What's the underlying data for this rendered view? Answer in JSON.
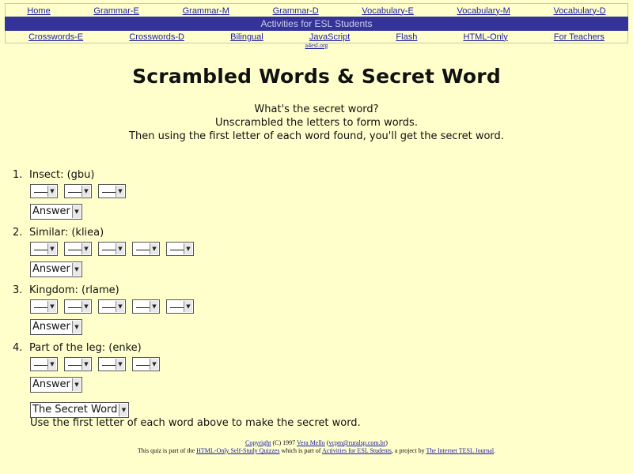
{
  "nav": {
    "row1": [
      "Home",
      "Grammar-E",
      "Grammar-M",
      "Grammar-D",
      "Vocabulary-E",
      "Vocabulary-M",
      "Vocabulary-D"
    ],
    "banner": "Activities for ESL Students",
    "row2": [
      "Crosswords-E",
      "Crosswords-D",
      "Bilingual",
      "JavaScript",
      "Flash",
      "HTML-Only",
      "For Teachers"
    ],
    "site_link": "a4esl.org"
  },
  "title": "Scrambled Words & Secret Word",
  "instructions": [
    "What's the secret word?",
    "Unscrambled the letters to form words.",
    "Then using the first letter of each word found, you'll get the secret word."
  ],
  "questions": [
    {
      "num": "1.",
      "label": "Insect: (gbu)",
      "letters": 3,
      "answer": "Answer"
    },
    {
      "num": "2.",
      "label": "Similar: (kliea)",
      "letters": 5,
      "answer": "Answer"
    },
    {
      "num": "3.",
      "label": "Kingdom: (rlame)",
      "letters": 5,
      "answer": "Answer"
    },
    {
      "num": "4.",
      "label": "Part of the leg: (enke)",
      "letters": 4,
      "answer": "Answer"
    }
  ],
  "secret": {
    "select": "The Secret Word",
    "hint": "Use the first letter of each word above to make the secret word."
  },
  "footer": {
    "copyright_link": "Copyright",
    "copyright_text": " (C) 1997 ",
    "author": "Vera Mello",
    "email": "vcpm@ruralsp.com.br",
    "line2_pre": "This quiz is part of the ",
    "quizzes_link": "HTML-Only Self-Study Quizzes",
    "line2_mid": " which is part of ",
    "activities_link": "Activities for ESL Students",
    "line2_mid2": ", a project by ",
    "journal_link": "The Internet TESL Journal",
    "line2_end": "."
  }
}
